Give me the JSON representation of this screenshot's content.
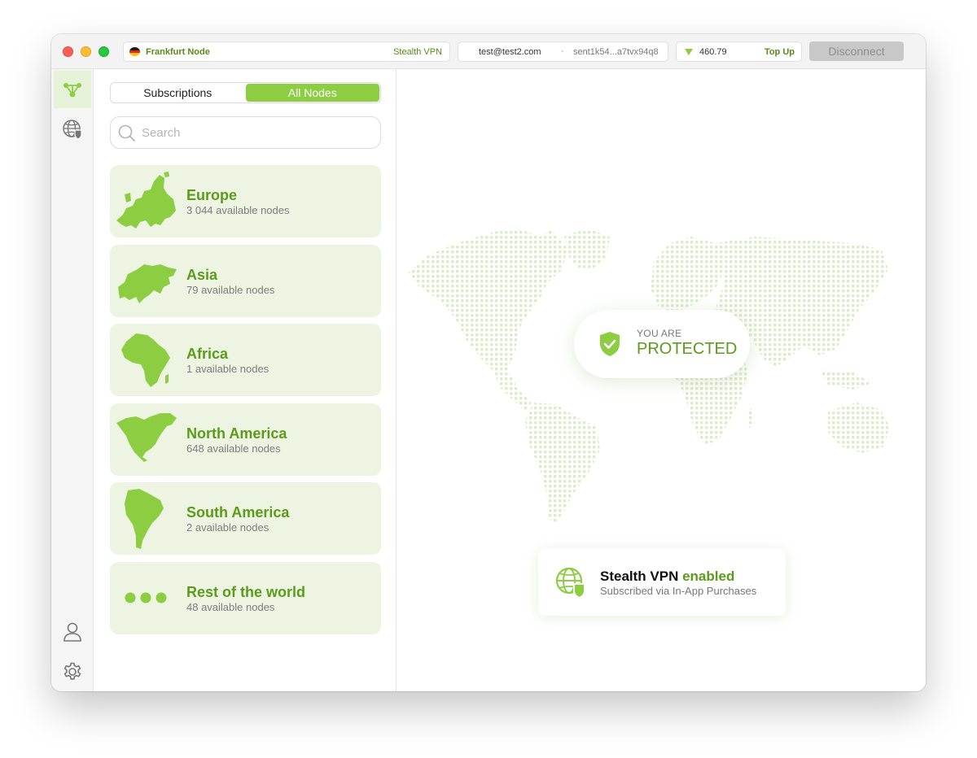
{
  "titlebar": {
    "node_name": "Frankfurt Node",
    "node_provider": "Stealth VPN",
    "account_email": "test@test2.com",
    "account_separator": "·",
    "account_address": "sent1k54...a7tvx94q8",
    "balance": "460.79",
    "top_up_label": "Top Up",
    "disconnect_label": "Disconnect"
  },
  "sidebar": {
    "items": [
      {
        "name": "nodes",
        "icon": "network-nodes-icon",
        "active": true
      },
      {
        "name": "globe",
        "icon": "globe-shield-icon",
        "active": false
      },
      {
        "name": "account",
        "icon": "user-icon",
        "active": false
      },
      {
        "name": "settings",
        "icon": "gear-icon",
        "active": false
      }
    ]
  },
  "tabs": {
    "subscriptions": "Subscriptions",
    "all_nodes": "All Nodes",
    "active": "all_nodes"
  },
  "search": {
    "placeholder": "Search"
  },
  "regions": [
    {
      "name": "Europe",
      "count": "3 044 available nodes",
      "icon": "europe-map-icon"
    },
    {
      "name": "Asia",
      "count": "79 available nodes",
      "icon": "asia-map-icon"
    },
    {
      "name": "Africa",
      "count": "1 available nodes",
      "icon": "africa-map-icon"
    },
    {
      "name": "North America",
      "count": "648 available nodes",
      "icon": "north-america-map-icon"
    },
    {
      "name": "South America",
      "count": "2 available nodes",
      "icon": "south-america-map-icon"
    },
    {
      "name": "Rest of the world",
      "count": "48 available nodes",
      "icon": "three-dots-icon"
    }
  ],
  "status": {
    "line1": "YOU ARE",
    "line2": "PROTECTED"
  },
  "subscription": {
    "title_prefix": "Stealth VPN",
    "title_suffix": "enabled",
    "description": "Subscribed via In-App Purchases"
  },
  "colors": {
    "accent": "#8ccd42",
    "accent_text": "#5c9a1b",
    "region_bg": "#edf5e2",
    "map_dot": "#dcebc8"
  }
}
